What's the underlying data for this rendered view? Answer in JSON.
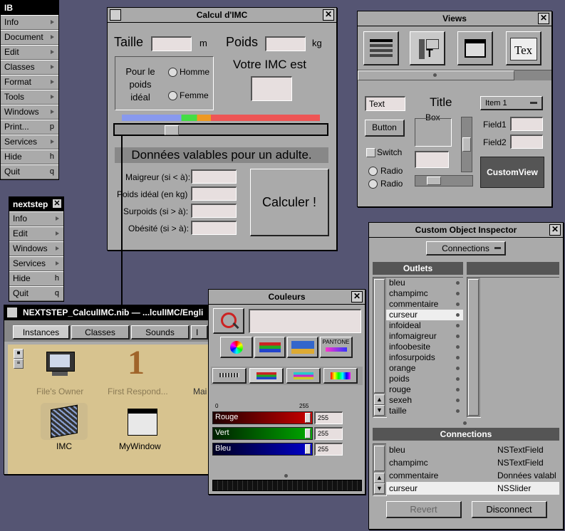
{
  "ib_menu": {
    "title": "IB",
    "items": [
      {
        "label": "Info",
        "key": ""
      },
      {
        "label": "Document",
        "key": ""
      },
      {
        "label": "Edit",
        "key": ""
      },
      {
        "label": "Classes",
        "key": ""
      },
      {
        "label": "Format",
        "key": ""
      },
      {
        "label": "Tools",
        "key": ""
      },
      {
        "label": "Windows",
        "key": ""
      },
      {
        "label": "Print...",
        "key": "p"
      },
      {
        "label": "Services",
        "key": ""
      },
      {
        "label": "Hide",
        "key": "h"
      },
      {
        "label": "Quit",
        "key": "q"
      }
    ]
  },
  "nextstep_menu": {
    "title": "nextstep",
    "items": [
      {
        "label": "Info",
        "key": ""
      },
      {
        "label": "Edit",
        "key": ""
      },
      {
        "label": "Windows",
        "key": ""
      },
      {
        "label": "Services",
        "key": ""
      },
      {
        "label": "Hide",
        "key": "h"
      },
      {
        "label": "Quit",
        "key": "q"
      }
    ]
  },
  "imc_window": {
    "title": "Calcul d'IMC",
    "taille_label": "Taille",
    "taille_unit": "m",
    "poids_label": "Poids",
    "poids_unit": "kg",
    "sexe_label": "Pour le poids idéal",
    "homme_label": "Homme",
    "femme_label": "Femme",
    "imc_label": "Votre IMC est",
    "banner": "Données valables pour un adulte.",
    "maigreur_label": "Maigreur (si < à):",
    "poids_ideal_label": "Poids idéal (en kg)",
    "surpoids_label": "Surpoids (si > à):",
    "obesite_label": "Obésité (si > à):",
    "calculer_label": "Calculer !",
    "slider_value": 0.25
  },
  "views_window": {
    "title": "Views",
    "text_field": "Text",
    "title_label": "Title",
    "popup_label": "Item 1",
    "box_label": "Box",
    "button_label": "Button",
    "field1_label": "Field1",
    "field2_label": "Field2",
    "switch_label": "Switch",
    "radio1_label": "Radio",
    "radio2_label": "Radio",
    "customview_label": "CustomView",
    "tab_icon_text": "Tex"
  },
  "inspector": {
    "title": "Custom Object Inspector",
    "popup": "Connections",
    "outlets_header": "Outlets",
    "outlets": [
      "bleu",
      "champimc",
      "commentaire",
      "curseur",
      "infoideal",
      "infomaigreur",
      "infoobesite",
      "infosurpoids",
      "orange",
      "poids",
      "rouge",
      "sexeh",
      "taille"
    ],
    "selected_outlet": "curseur",
    "connections_header": "Connections",
    "connections": [
      {
        "name": "bleu",
        "type": "NSTextField"
      },
      {
        "name": "champimc",
        "type": "NSTextField"
      },
      {
        "name": "commentaire",
        "type": "Données valabl"
      },
      {
        "name": "curseur",
        "type": "NSSlider"
      }
    ],
    "revert_label": "Revert",
    "disconnect_label": "Disconnect"
  },
  "colors_window": {
    "title": "Couleurs",
    "pantone_label": "PANTONE",
    "scale_min": "0",
    "scale_max": "255",
    "sliders": [
      {
        "label": "Rouge",
        "value": "255",
        "color": "#cc0000"
      },
      {
        "label": "Vert",
        "value": "255",
        "color": "#00aa00"
      },
      {
        "label": "Bleu",
        "value": "255",
        "color": "#0000cc"
      }
    ]
  },
  "nib_window": {
    "title": "NEXTSTEP_CalculIMC.nib — ...lculIMC/Engli",
    "tabs": [
      "Instances",
      "Classes",
      "Sounds",
      "I"
    ],
    "icons": [
      {
        "label": "File's Owner"
      },
      {
        "label": "First Respond..."
      },
      {
        "label": "Mai"
      },
      {
        "label": "IMC"
      },
      {
        "label": "MyWindow"
      }
    ],
    "first_responder_digit": "1"
  }
}
